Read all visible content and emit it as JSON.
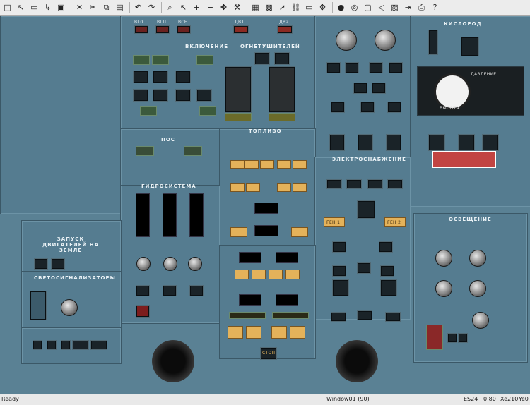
{
  "toolbar": {
    "icons": [
      "new-icon",
      "cursor-icon",
      "open-icon",
      "open-arrow-icon",
      "save-icon",
      "close-icon",
      "cut-icon",
      "copy-icon",
      "paste-icon",
      "undo-icon",
      "redo-icon",
      "zoom-icon",
      "select-arrow-icon",
      "zoom-in-icon",
      "zoom-out-icon",
      "move-icon",
      "wrench-icon",
      "grid-icon",
      "layers-icon",
      "arrow-icon",
      "link-icon",
      "note-icon",
      "tools-icon",
      "stop-icon",
      "map-icon",
      "window-icon",
      "back-icon",
      "image-icon",
      "export-icon",
      "print-icon",
      "help-icon"
    ]
  },
  "panel": {
    "top_small": [
      "ВГ0",
      "ВГП",
      "ВСН",
      "ДВ1",
      "ДВ2"
    ],
    "section_vkl": "ВКЛЮЧЕНИЕ",
    "section_fire": "ОГНЕТУШИТЕЛЕЙ",
    "section_pos": "ПОС",
    "section_hydro": "ГИДРОСИСТЕМА",
    "section_fuel": "ТОПЛИВО",
    "section_elec": "ЭЛЕКТРОСНАБЖЕНИЕ",
    "section_oxygen": "КИСЛОРОД",
    "section_engine": "ЗАПУСК ДВИГАТЕЛЕЙ НА ЗЕМЛЕ",
    "section_signal": "СВЕТОСИГНАЛИЗАТОРЫ",
    "section_light": "ОСВЕЩЕНИЕ",
    "gen1": "ГЕН 1",
    "gen2": "ГЕН 2",
    "stop": "СТОП",
    "alt": "ВЫСОТА",
    "pressure": "ДАВЛЕНИЕ"
  },
  "status": {
    "left": "Ready",
    "window": "Window01 (90)",
    "code": "ES24",
    "zoom": "0.80",
    "xy": "Xe210",
    "y": "Ye0"
  }
}
